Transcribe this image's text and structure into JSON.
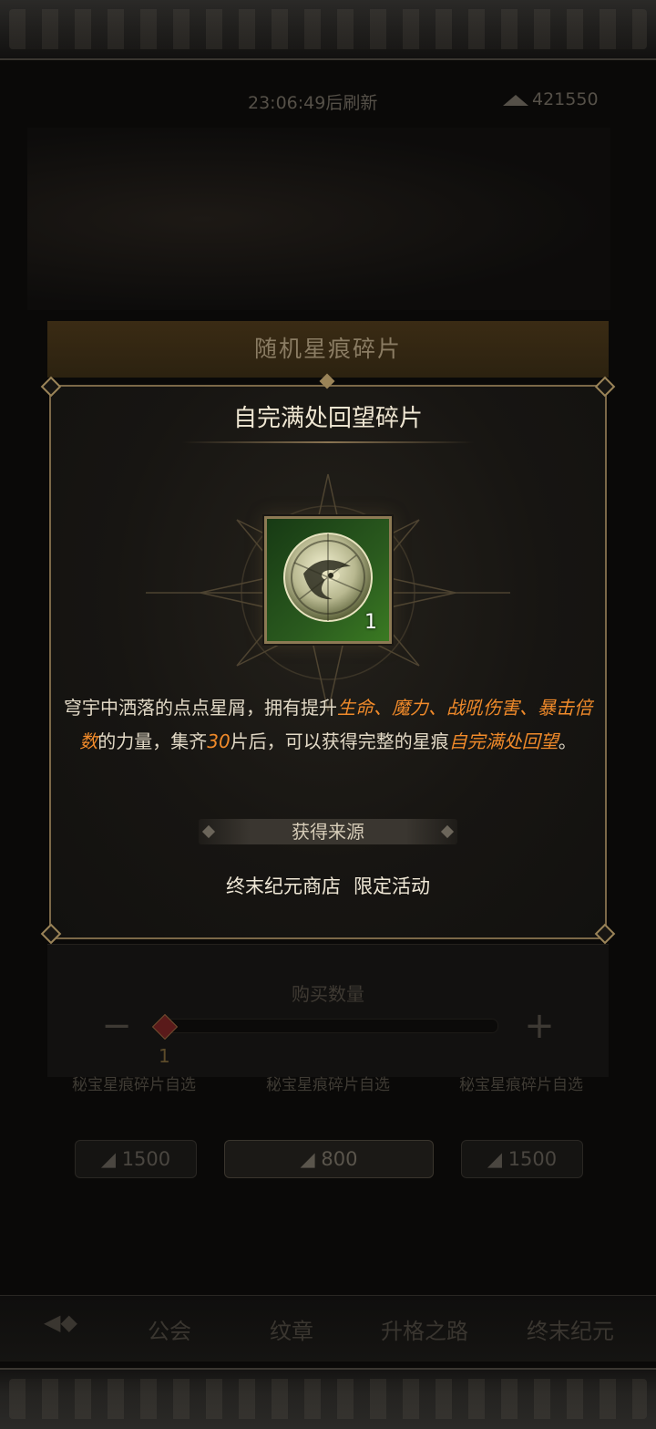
{
  "header": {
    "refresh_text": "23:06:49后刷新",
    "currency_amount": "421550"
  },
  "shop": {
    "items": [
      {
        "name": "秘宝星痕碎片自选",
        "price": "1500"
      },
      {
        "name": "秘宝星痕碎片自选",
        "price": "800"
      },
      {
        "name": "秘宝星痕碎片自选",
        "price": "1500"
      }
    ],
    "buy_label": "购买数量",
    "quantity": "1",
    "minus_symbol": "−",
    "plus_symbol": "+"
  },
  "nav": {
    "items": [
      "公会",
      "纹章",
      "升格之路",
      "终末纪元"
    ]
  },
  "modal": {
    "header_title": "随机星痕碎片",
    "item_title": "自完满处回望碎片",
    "item_count": "1",
    "description": {
      "p1": "穹宇中洒落的点点星屑，拥有提升",
      "h1": "生命",
      "s1": "、",
      "h2": "魔力",
      "s2": "、",
      "h3": "战吼伤害",
      "s3": "、",
      "h4": "暴击倍数",
      "p2": "的力量，集齐",
      "h5": "30",
      "p3": "片后，可以获得完整的星痕",
      "h6": "自完满处回望",
      "p4": "。"
    },
    "source_label": "获得来源",
    "sources": [
      "终末纪元商店",
      "限定活动"
    ]
  },
  "colors": {
    "highlight": "#f08a2a",
    "frame_gold": "#7b6848",
    "icon_green": "#2a5a1e"
  }
}
